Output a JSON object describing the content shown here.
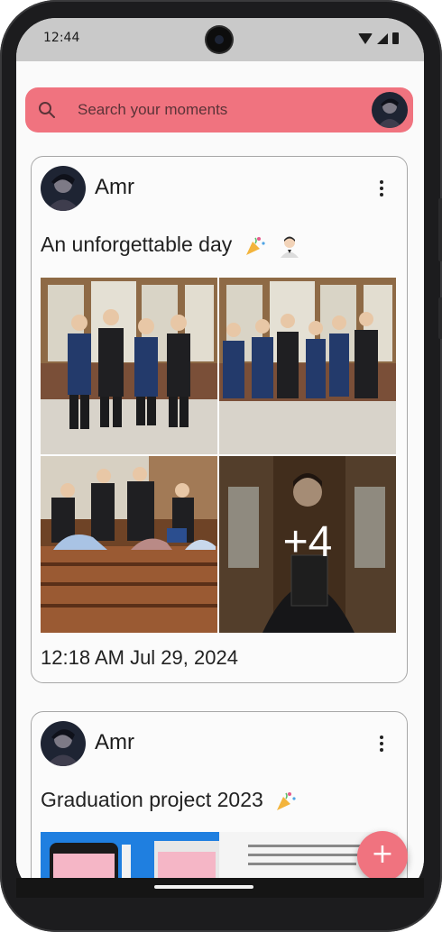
{
  "status_bar": {
    "time": "12:44"
  },
  "search": {
    "placeholder": "Search your moments",
    "icon": "search-icon"
  },
  "posts": [
    {
      "author": "Amr",
      "title": "An unforgettable day",
      "title_emojis": [
        "party-popper-icon",
        "person-in-tuxedo-icon"
      ],
      "extra_images": "+4",
      "timestamp": "12:18 AM Jul 29, 2024"
    },
    {
      "author": "Amr",
      "title": "Graduation project 2023",
      "title_emojis": [
        "party-popper-icon"
      ]
    }
  ],
  "fab": {
    "label": "+"
  },
  "colors": {
    "accent": "#f0737f",
    "text": "#222222",
    "card_border": "#a7a7a7",
    "background": "#fafafa"
  }
}
